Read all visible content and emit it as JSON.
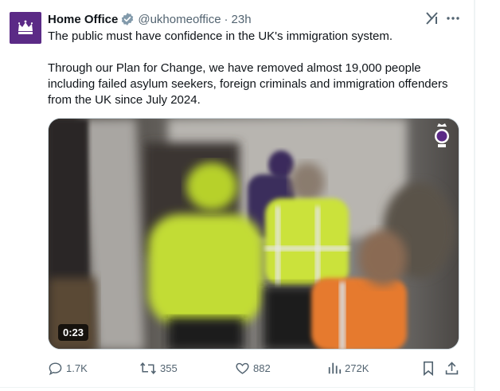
{
  "account": {
    "name": "Home Office",
    "handle": "@ukhomeoffice",
    "separator": "·",
    "time": "23h"
  },
  "tweet": {
    "paragraph_1": "The public must have confidence in the UK's immigration system.",
    "paragraph_2": "Through our Plan for Change, we have removed almost 19,000 people including failed asylum seekers, foreign criminals and immigration offenders from the UK since July 2024."
  },
  "media": {
    "duration": "0:23"
  },
  "actions": {
    "replies": "1.7K",
    "reposts": "355",
    "likes": "882",
    "views": "272K"
  },
  "colors": {
    "avatar_bg": "#5b2a86",
    "verified": "#829aab",
    "muted_text": "#536471"
  },
  "icons": [
    "crown-icon",
    "verified-badge-icon",
    "grok-icon",
    "more-icon",
    "reply-icon",
    "repost-icon",
    "like-icon",
    "views-icon",
    "bookmark-icon",
    "share-icon"
  ]
}
